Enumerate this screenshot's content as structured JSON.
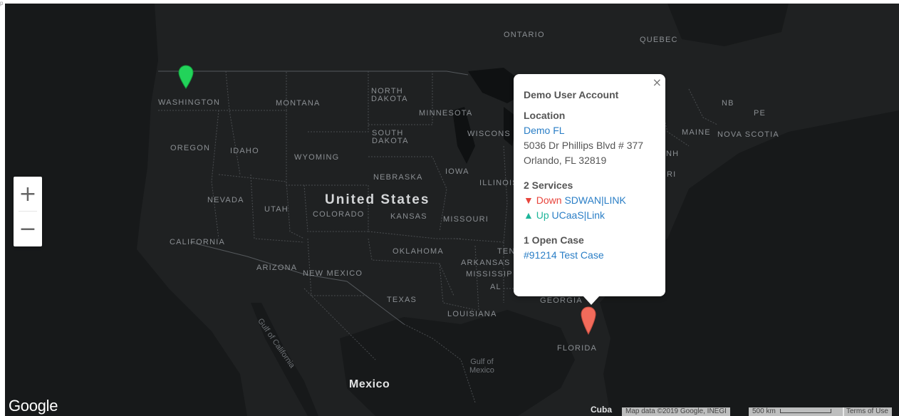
{
  "map": {
    "labels": {
      "ontario": "ONTARIO",
      "quebec": "QUEBEC",
      "washington": "WASHINGTON",
      "montana": "MONTANA",
      "north_dakota": "NORTH\nDAKOTA",
      "minnesota": "MINNESOTA",
      "south_dakota": "SOUTH\nDAKOTA",
      "wisconsin": "WISCONS",
      "oregon": "OREGON",
      "idaho": "IDAHO",
      "wyoming": "WYOMING",
      "nebraska": "NEBRASKA",
      "iowa": "IOWA",
      "illinois": "ILLINOIS",
      "nevada": "NEVADA",
      "utah": "UTAH",
      "united_states": "United States",
      "colorado": "COLORADO",
      "kansas": "KANSAS",
      "missouri": "MISSOURI",
      "california": "CALIFORNIA",
      "oklahoma": "OKLAHOMA",
      "tennessee": "TEN",
      "arkansas": "ARKANSAS",
      "mississippi": "MISSISSIP",
      "arizona": "ARIZONA",
      "new_mexico": "NEW MEXICO",
      "texas": "TEXAS",
      "louisiana": "LOUISIANA",
      "alabama": "AL",
      "georgia": "GEORGIA",
      "florida": "FLORIDA",
      "nb": "NB",
      "pe": "PE",
      "maine": "MAINE",
      "nova_scotia": "NOVA SCOTIA",
      "nh": "NH",
      "ri": "RI",
      "gulf_of_california": "Gulf of California",
      "gulf_of_mexico": "Gulf of\nMexico",
      "mexico": "Mexico",
      "cuba": "Cuba"
    },
    "google_logo": "Google",
    "attribution": "Map data ©2019 Google, INEGI",
    "scale": "500 km",
    "terms": "Terms of Use"
  },
  "zoom": {
    "in": "+",
    "out": "−"
  },
  "markers": [
    {
      "name": "washington-site",
      "color": "#22d35a",
      "status": "up"
    },
    {
      "name": "orlando-site",
      "color": "#f26b5b",
      "status": "down"
    }
  ],
  "popup": {
    "close": "×",
    "title": "Demo User Account",
    "location_heading": "Location",
    "location_name": "Demo FL",
    "address_line1": "5036 Dr Phillips Blvd # 377",
    "address_line2": "Orlando, FL 32819",
    "services_heading": "2 Services",
    "services": [
      {
        "arrow": "▼",
        "status": "Down",
        "name": "SDWAN|LINK"
      },
      {
        "arrow": "▲",
        "status": "Up",
        "name": "UCaaS|Link"
      }
    ],
    "cases_heading": "1 Open Case",
    "case_link": "#91214 Test Case"
  },
  "colors": {
    "map_bg": "#1f2122",
    "land": "#2b2d2f",
    "water": "#17191a",
    "link": "#2a7ec6",
    "down": "#e8453c",
    "up": "#1eb59a"
  }
}
